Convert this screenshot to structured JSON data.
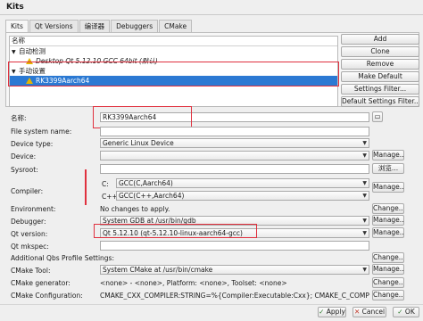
{
  "window": {
    "title": "Kits"
  },
  "tabs": [
    "Kits",
    "Qt Versions",
    "编译器",
    "Debuggers",
    "CMake"
  ],
  "tree": {
    "column_header": "名称",
    "auto_group": "自动检测",
    "auto_item": "Desktop Qt 5.12.10 GCC 64bit (默认)",
    "manual_group": "手动设置",
    "manual_item": "RK3399Aarch64"
  },
  "side_buttons": {
    "add": "Add",
    "clone": "Clone",
    "remove": "Remove",
    "make_default": "Make Default",
    "settings_filter": "Settings Filter...",
    "default_settings_filter": "Default Settings Filter..."
  },
  "form": {
    "name_label": "名称:",
    "name_value": "RK3399Aarch64",
    "fs_label": "File system name:",
    "fs_value": "",
    "device_type_label": "Device type:",
    "device_type_value": "Generic Linux Device",
    "device_label": "Device:",
    "device_value": "",
    "sysroot_label": "Sysroot:",
    "sysroot_value": "",
    "browse": "浏览...",
    "compiler_label": "Compiler:",
    "c_label": "C:",
    "c_value": "GCC(C,Aarch64)",
    "cpp_label": "C++:",
    "cpp_value": "GCC(C++,Aarch64)",
    "environment_label": "Environment:",
    "environment_value": "No changes to apply.",
    "debugger_label": "Debugger:",
    "debugger_value": "System GDB at /usr/bin/gdb",
    "qt_version_label": "Qt version:",
    "qt_version_value": "Qt 5.12.10 (qt-5.12.10-linux-aarch64-gcc)",
    "qt_mkspec_label": "Qt mkspec:",
    "qt_mkspec_value": "",
    "qbs_label": "Additional Qbs Profile Settings:",
    "cmake_tool_label": "CMake Tool:",
    "cmake_tool_value": "System CMake at /usr/bin/cmake",
    "cmake_generator_label": "CMake generator:",
    "cmake_generator_value": "<none> - <none>, Platform: <none>, Toolset: <none>",
    "cmake_config_label": "CMake Configuration:",
    "cmake_config_value": "CMAKE_CXX_COMPILER:STRING=%{Compiler:Executable:Cxx}; CMAKE_C_COMPILER:STRING=%{",
    "manage": "Manage...",
    "change": "Change..."
  },
  "footer": {
    "apply": "Apply",
    "cancel": "Cancel",
    "ok": "OK"
  },
  "colors": {
    "selection": "#2b79d3",
    "highlight_border": "#e0303e",
    "warning": "#e5b400"
  }
}
